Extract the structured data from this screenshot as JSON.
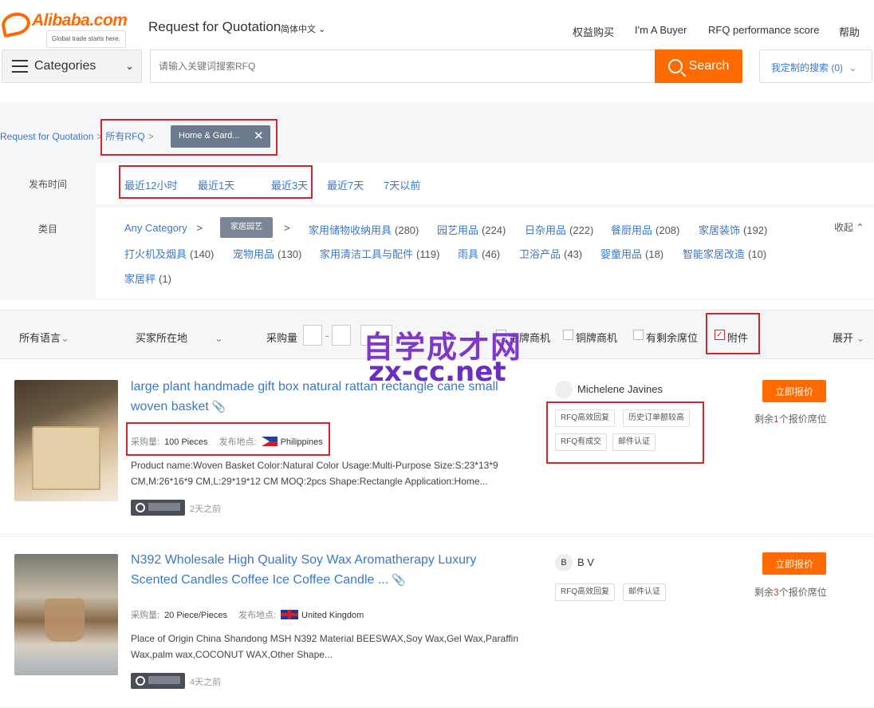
{
  "header": {
    "logo_word": "Alibaba.com",
    "logo_tagline": "Global trade starts here.",
    "title": "Request for Quotation",
    "language": "简体中文",
    "nav": [
      "权益购买",
      "I'm A Buyer",
      "RFQ performance score",
      "帮助"
    ]
  },
  "search": {
    "categories_label": "Categories",
    "placeholder": "请输入关键词搜索RFQ",
    "button_label": "Search",
    "custom_search": "我定制的搜索 (0)"
  },
  "breadcrumb": {
    "root": "Request for Quotation",
    "all": "所有RFQ",
    "chip": "Home & Gard..."
  },
  "filters": {
    "time_label": "发布时间",
    "time_options": [
      "最近12小时",
      "最近1天",
      "最近3天",
      "最近7天",
      "7天以前"
    ],
    "category_label": "类目",
    "any_category": "Any Category",
    "current_category": "家居园艺",
    "collapse": "收起",
    "categories": [
      {
        "name": "家用储物收纳用具",
        "count": "(280)"
      },
      {
        "name": "园艺用品",
        "count": "(224)"
      },
      {
        "name": "日杂用品",
        "count": "(222)"
      },
      {
        "name": "餐厨用品",
        "count": "(208)"
      },
      {
        "name": "家居装饰",
        "count": "(192)"
      },
      {
        "name": "打火机及烟具",
        "count": "(140)"
      },
      {
        "name": "宠物用品",
        "count": "(130)"
      },
      {
        "name": "家用清洁工具与配件",
        "count": "(119)"
      },
      {
        "name": "雨具",
        "count": "(46)"
      },
      {
        "name": "卫浴产品",
        "count": "(43)"
      },
      {
        "name": "婴童用品",
        "count": "(18)"
      },
      {
        "name": "智能家居改造",
        "count": "(10)"
      },
      {
        "name": "家居秤",
        "count": "(1)"
      }
    ]
  },
  "sortbar": {
    "language": "所有语言",
    "buyer_location": "买家所在地",
    "quantity": "采购量",
    "check1": "金牌商机",
    "check2": "铜牌商机",
    "check3": "有剩余席位",
    "check4": "附件",
    "expand": "展开"
  },
  "watermark": {
    "line1": "自学成才网",
    "line2": "zx-cc.net"
  },
  "listings": [
    {
      "title": "large plant handmade gift box natural rattan rectangle cane small woven basket",
      "qty_label": "采购量:",
      "qty": "100 Pieces",
      "loc_label": "发布地点:",
      "location": "Philippines",
      "description": "Product name:Woven Basket Color:Natural Color Usage:Multi-Purpose Size:S:23*13*9 CM,M:26*16*9 CM,L:29*19*12 CM MOQ:2pcs Shape:Rectangle Application:Home...",
      "ago": "2天之前",
      "buyer_initial": "",
      "buyer": "Michelene Javines",
      "tags": [
        "RFQ高效回复",
        "历史订单额较高",
        "RFQ有成交",
        "邮件认证"
      ],
      "quote": "立即报价",
      "remain_pre": "剩余",
      "remain_num": "1",
      "remain_post": "个报价席位"
    },
    {
      "title": "N392 Wholesale High Quality Soy Wax Aromatherapy Luxury Scented Candles Coffee Ice Coffee Candle ...",
      "qty_label": "采购量:",
      "qty": "20 Piece/Pieces",
      "loc_label": "发布地点:",
      "location": "United Kingdom",
      "description": "Place of Origin China Shandong MSH N392 Material BEESWAX,Soy Wax,Gel Wax,Paraffin Wax,palm wax,COCONUT WAX,Other Shape...",
      "ago": "4天之前",
      "buyer_initial": "B",
      "buyer": "B V",
      "tags": [
        "RFQ高效回复",
        "邮件认证"
      ],
      "quote": "立即报价",
      "remain_pre": "剩余",
      "remain_num": "3",
      "remain_post": "个报价席位"
    }
  ]
}
